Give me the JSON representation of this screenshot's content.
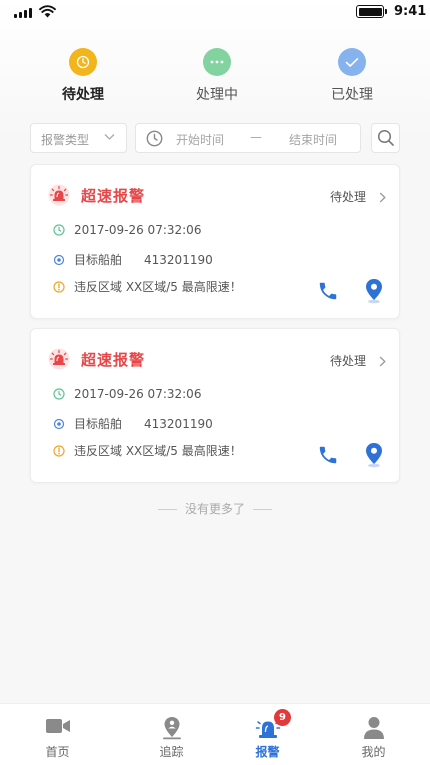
{
  "status_bar": {
    "time": "9:41"
  },
  "tabs": [
    {
      "label": "待处理",
      "color": "#f2b51c",
      "active": true
    },
    {
      "label": "处理中",
      "color": "#82d3a0",
      "active": false
    },
    {
      "label": "已处理",
      "color": "#86b3ee",
      "active": false
    }
  ],
  "filters": {
    "type_placeholder": "报警类型",
    "start_placeholder": "开始时间",
    "separator": "—",
    "end_placeholder": "结束时间"
  },
  "alarms": [
    {
      "title": "超速报警",
      "status": "待处理",
      "time": "2017-09-26  07:32:06",
      "target_label": "目标船舶",
      "target_value": "413201190",
      "violation": "违反区域  XX区域/5  最高限速！"
    },
    {
      "title": "超速报警",
      "status": "待处理",
      "time": "2017-09-26  07:32:06",
      "target_label": "目标船舶",
      "target_value": "413201190",
      "violation": "违反区域  XX区域/5  最高限速！"
    }
  ],
  "list_end_text": "没有更多了",
  "bottom_nav": {
    "items": [
      {
        "label": "首页",
        "icon": "video-icon"
      },
      {
        "label": "追踪",
        "icon": "location-person-icon"
      },
      {
        "label": "报警",
        "icon": "alarm-siren-icon",
        "badge": "9"
      },
      {
        "label": "我的",
        "icon": "user-icon"
      }
    ]
  },
  "colors": {
    "alarm_red": "#e8474a",
    "accent_blue": "#2e72d8",
    "clock_green": "#5cc593",
    "target_blue": "#4d84db",
    "warning_orange": "#f0a52a"
  }
}
